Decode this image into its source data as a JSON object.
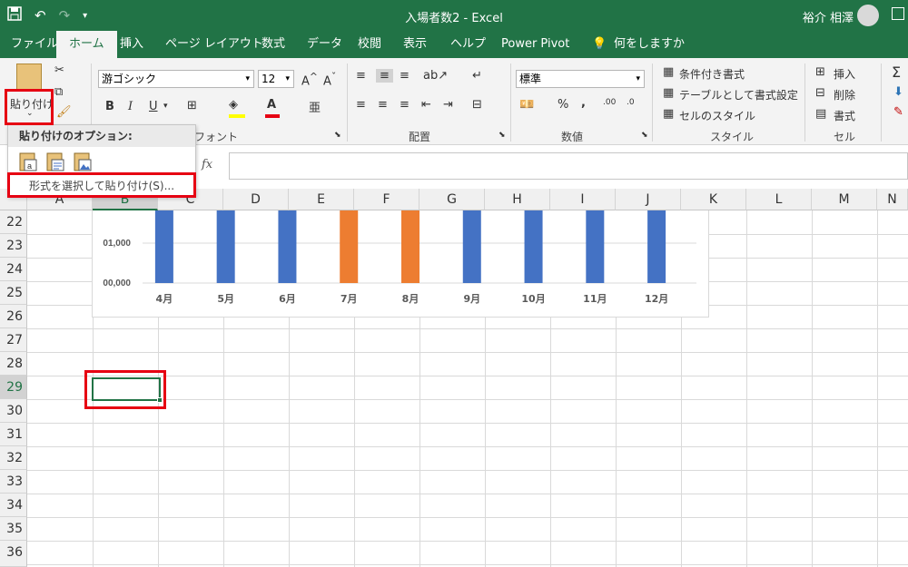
{
  "window": {
    "title": "入場者数2  -  Excel",
    "user": "裕介 相澤"
  },
  "tabs": [
    "ファイル",
    "ホーム",
    "挿入",
    "ページ レイアウト",
    "数式",
    "データ",
    "校閲",
    "表示",
    "ヘルプ",
    "Power Pivot",
    "何をしますか"
  ],
  "ribbon": {
    "paste_label": "貼り付け",
    "font_name": "游ゴシック",
    "font_size": "12",
    "font_group": "フォント",
    "align_group": "配置",
    "number_format": "標準",
    "number_group": "数値",
    "styles": {
      "conditional": "条件付き書式",
      "table": "テーブルとして書式設定",
      "cell_style": "セルのスタイル",
      "label": "スタイル"
    },
    "cells": {
      "insert": "挿入",
      "delete": "削除",
      "format": "書式",
      "label": "セル"
    },
    "bold": "B",
    "italic": "I",
    "underline": "U",
    "percent": "%",
    "comma": ","
  },
  "paste_menu": {
    "header": "貼り付けのオプション:",
    "special": "形式を選択して貼り付け(S)..."
  },
  "formula_bar": {
    "fx": "fx",
    "value": ""
  },
  "columns": [
    "A",
    "B",
    "C",
    "D",
    "E",
    "F",
    "G",
    "H",
    "I",
    "J",
    "K",
    "L",
    "M",
    "N"
  ],
  "rows": [
    "22",
    "23",
    "24",
    "25",
    "26",
    "27",
    "28",
    "29",
    "30",
    "31",
    "32",
    "33",
    "34",
    "35",
    "36"
  ],
  "selected": {
    "column": "B",
    "row": "29"
  },
  "chart_data": {
    "type": "bar",
    "categories": [
      "4月",
      "5月",
      "6月",
      "7月",
      "8月",
      "9月",
      "10月",
      "11月",
      "12月"
    ],
    "y_tick_labels": [
      "01,000",
      "00,000"
    ],
    "bar_colors": [
      "#4472c4",
      "#4472c4",
      "#4472c4",
      "#ed7d31",
      "#ed7d31",
      "#4472c4",
      "#4472c4",
      "#4472c4",
      "#4472c4"
    ],
    "note": "Only the lower portion of the chart is visible; all bars extend above the visible area."
  },
  "colors": {
    "excel_green": "#217346",
    "highlight_red": "#e60012",
    "bar_blue": "#4472c4",
    "bar_orange": "#ed7d31"
  }
}
